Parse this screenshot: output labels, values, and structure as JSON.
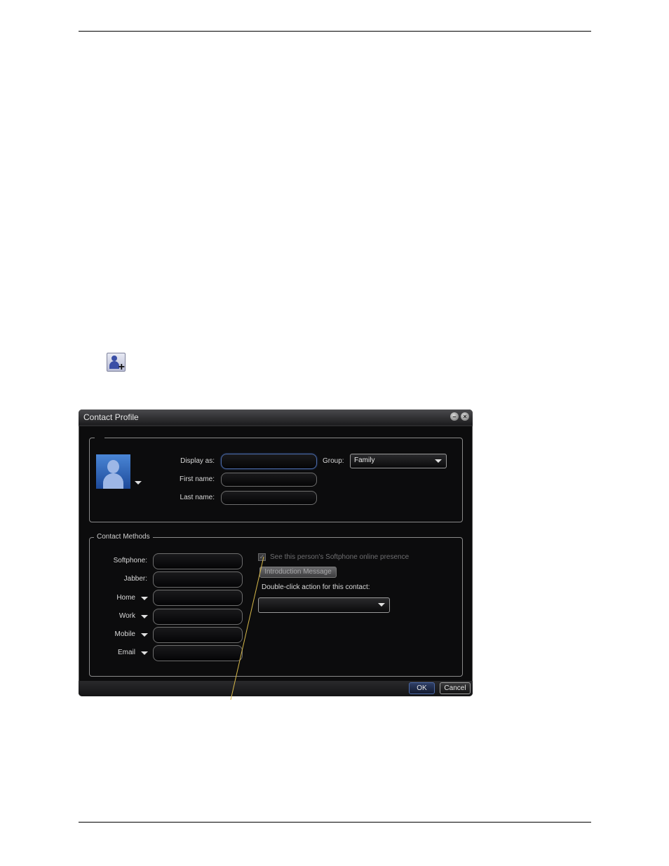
{
  "dialog": {
    "title": "Contact Profile",
    "display_as_label": "Display as:",
    "first_name_label": "First name:",
    "last_name_label": "Last name:",
    "group_label": "Group:",
    "group_value": "Family",
    "contact_methods_legend": "Contact Methods",
    "methods": [
      {
        "label": "Softphone:"
      },
      {
        "label": "Jabber:"
      },
      {
        "label": "Home"
      },
      {
        "label": "Work"
      },
      {
        "label": "Mobile"
      },
      {
        "label": "Email"
      }
    ],
    "presence_checkbox_label": "See this person's Softphone online presence",
    "intro_button": "Introduction Message",
    "double_click_label": "Double-click action for this contact:",
    "ok_button": "OK",
    "cancel_button": "Cancel"
  },
  "colors": {
    "window_bg": "#0c0c0d",
    "callout_line": "#d6b84a",
    "focus_border": "#4c6aa8"
  },
  "icons": {
    "add_contact": "add-contact-icon",
    "avatar": "user-silhouette-icon",
    "minimize": "minimize-icon",
    "close": "close-icon"
  }
}
